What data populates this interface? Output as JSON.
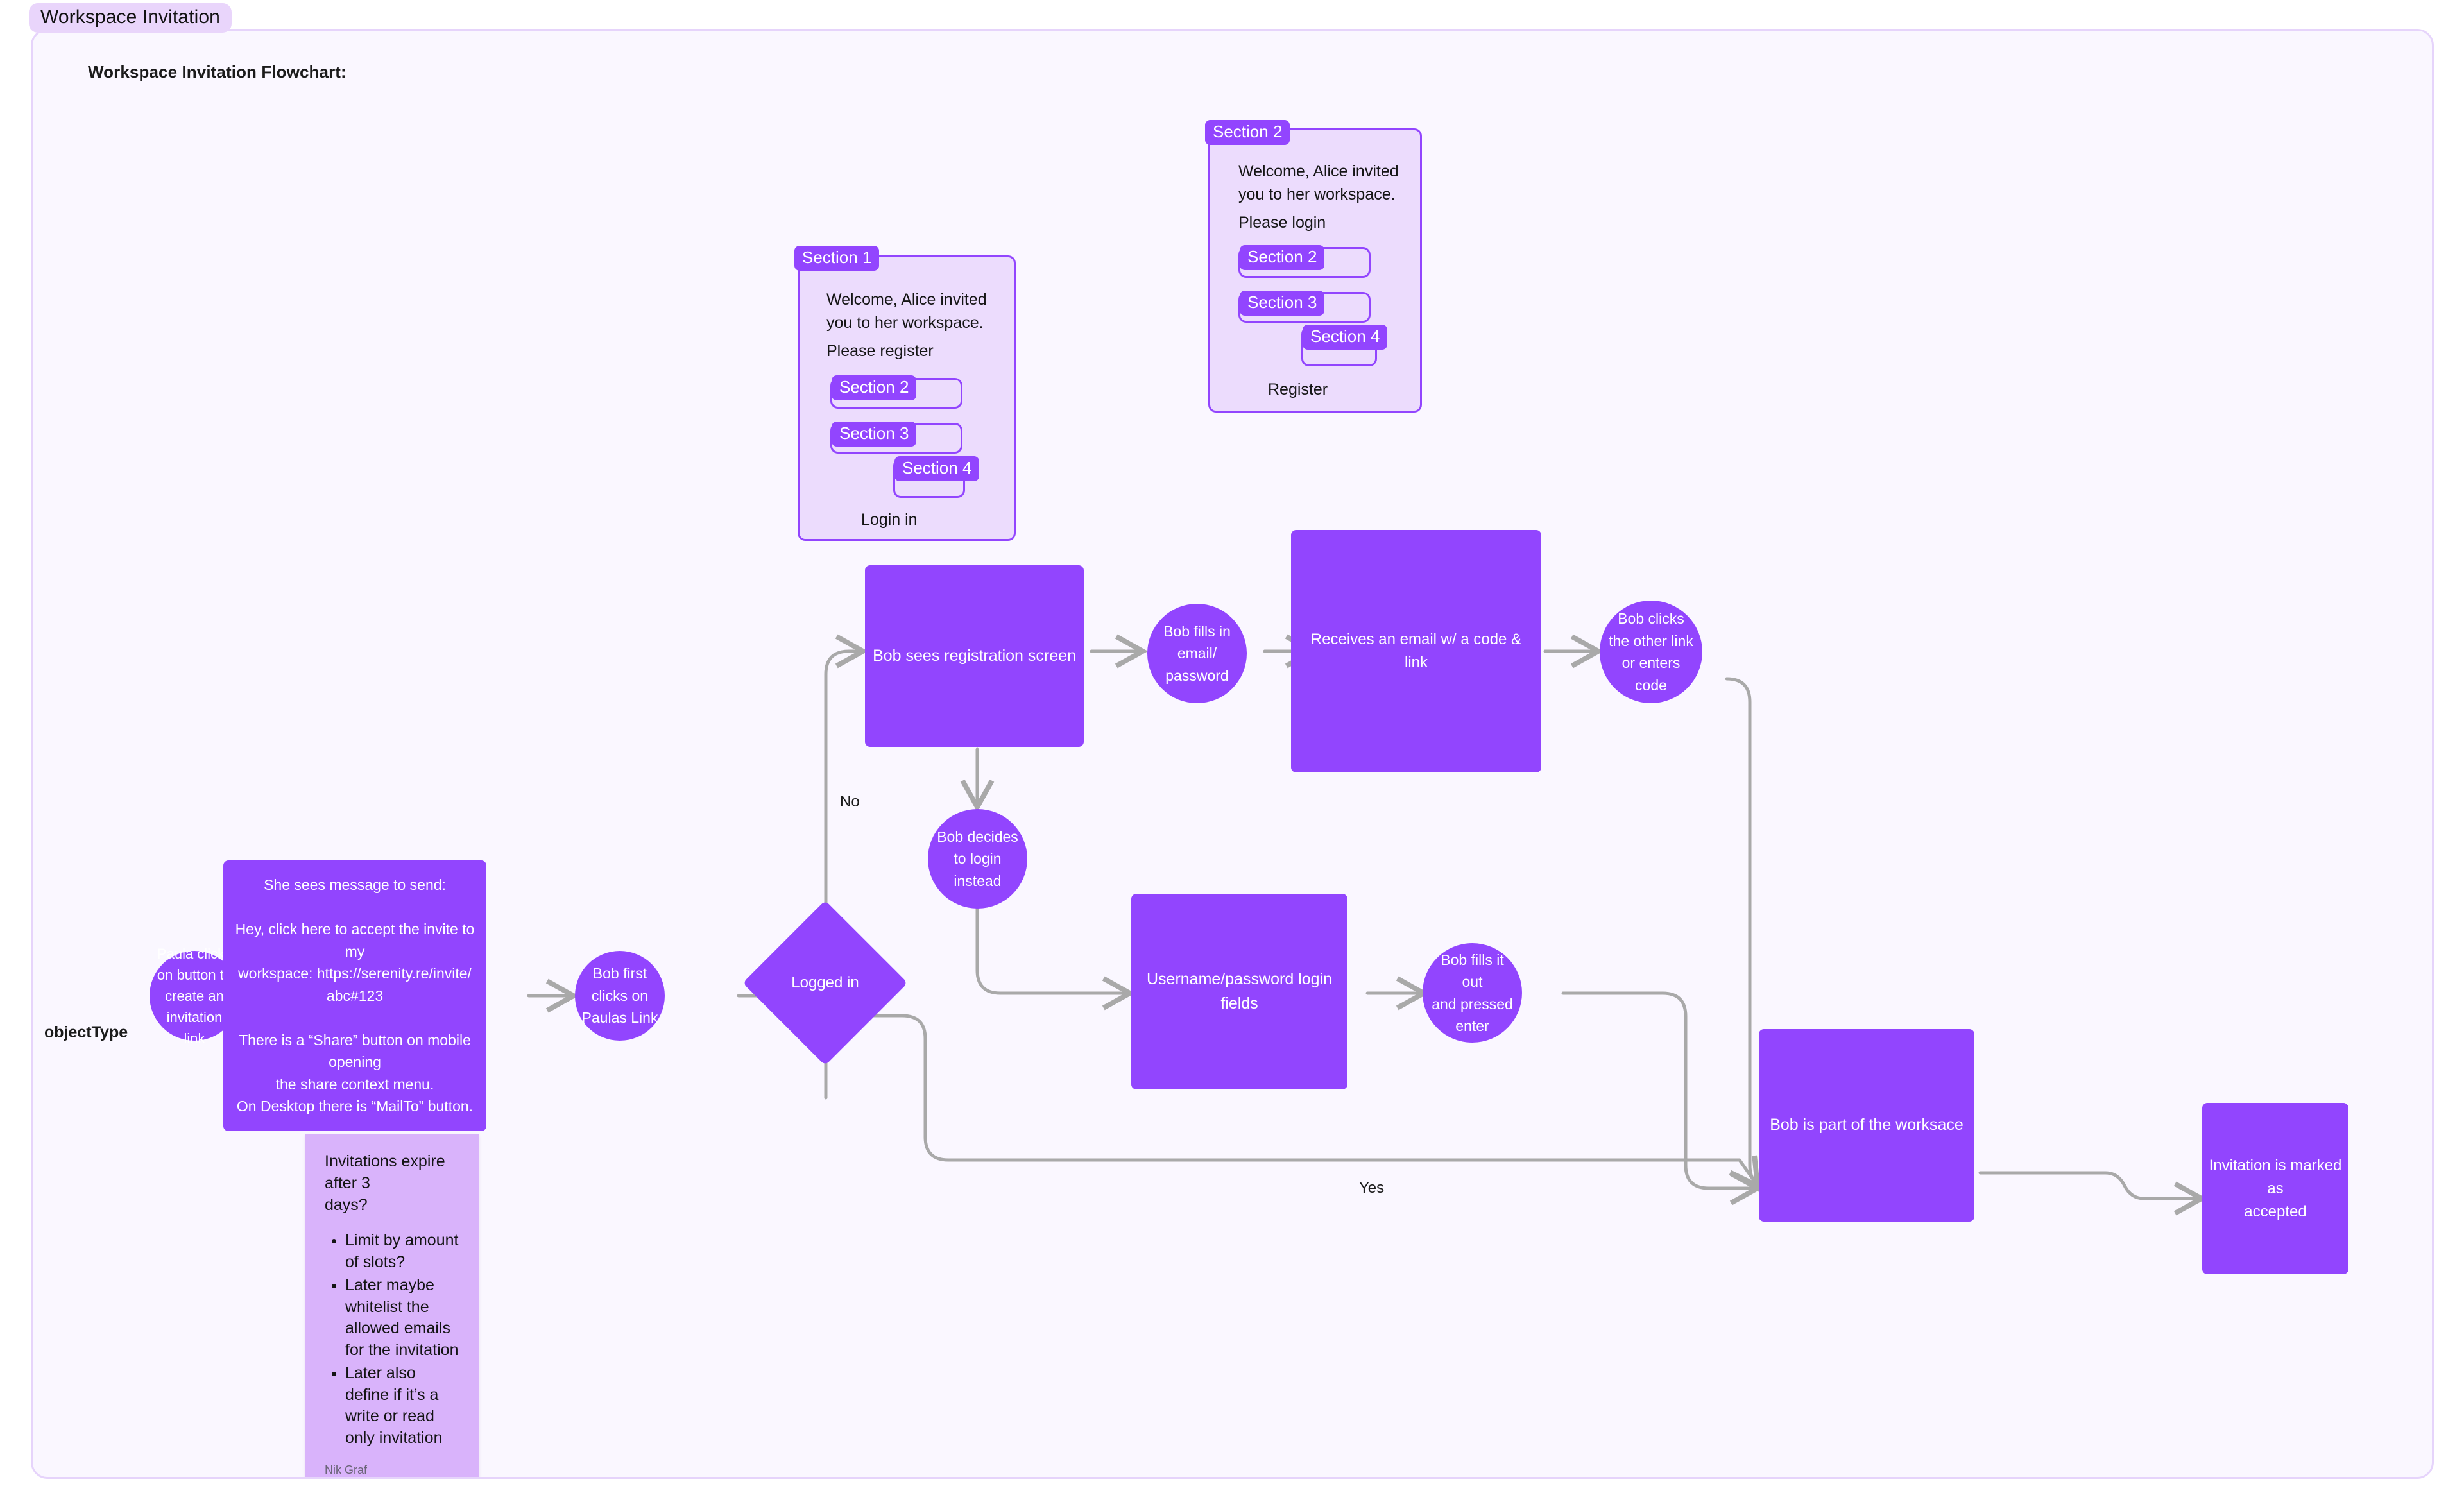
{
  "tab": {
    "label": "Workspace Invitation"
  },
  "board": {
    "title": "Workspace Invitation Flowchart:"
  },
  "mockups": [
    {
      "badge": "Section 1",
      "body": "Welcome, Alice invited\nyou to her workspace.",
      "prompt": "Please register",
      "fields": [
        "Section 2",
        "Section 3",
        "Section 4"
      ],
      "footer": "Login in"
    },
    {
      "badge": "Section 2",
      "body": "Welcome, Alice invited\nyou to her workspace.",
      "prompt": "Please login",
      "fields": [
        "Section 2",
        "Section 3",
        "Section 4"
      ],
      "footer": "Register"
    }
  ],
  "labels": {
    "object_type": "objectType",
    "edge_no": "No",
    "edge_yes": "Yes"
  },
  "nodes": {
    "paula_clicks": "Paula clicks\non button to\ncreate an\ninvitation link",
    "message_box": "She sees message to send:\n\nHey, click here to accept the invite to my\nworkspace: https://serenity.re/invite/\nabc#123\n\nThere is a “Share” button on mobile opening\nthe share context menu.\nOn Desktop there is “MailTo” button.",
    "bob_first_clicks": "Bob first\nclicks on\nPaulas Link",
    "logged_in": "Logged in",
    "registration_screen": "Bob sees registration screen",
    "bob_fills_email": "Bob fills in\nemail/\npassword",
    "receives_email": "Receives an email w/ a code & link",
    "bob_clicks_other_link": "Bob clicks\nthe other link\nor enters\ncode",
    "bob_decides_login": "Bob decides\nto login\ninstead",
    "login_fields": "Username/password login fields",
    "bob_fills_enter": "Bob fills it out\nand pressed\nenter",
    "bob_part_workspace": "Bob is part of the worksace",
    "invitation_accepted": "Invitation is marked as\naccepted"
  },
  "sticky": {
    "heading": "Invitations expire after 3\ndays?",
    "bullets": [
      "Limit by amount of slots?",
      "Later maybe whitelist the allowed emails for the invitation",
      "Later also define if it’s a write or read only invitation"
    ],
    "author": "Nik Graf"
  },
  "colors": {
    "node_purple": "#9245fe",
    "canvas_bg": "#faf7ff",
    "canvas_border": "#e6d4fb",
    "tab_bg": "#e9d5fb",
    "mock_bg": "#ecdcfd",
    "sticky_bg": "#d9b3fb",
    "edge_gray": "#a9a9a9"
  }
}
